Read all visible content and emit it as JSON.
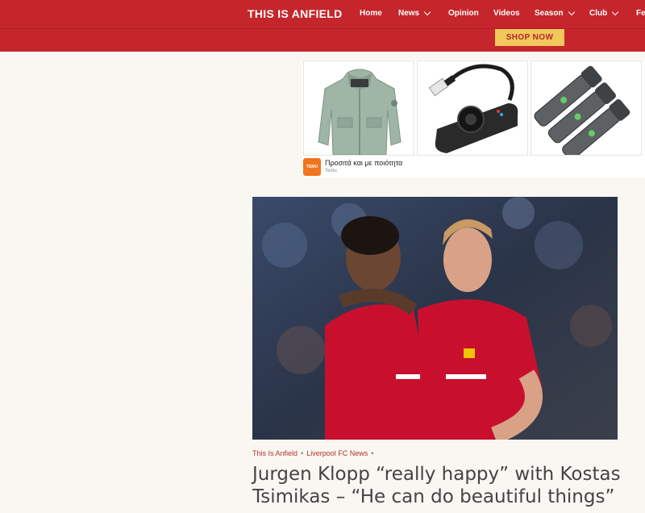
{
  "header": {
    "brand": "THIS IS ANFIELD",
    "nav": [
      {
        "label": "Home",
        "has_dropdown": false
      },
      {
        "label": "News",
        "has_dropdown": true
      },
      {
        "label": "Opinion",
        "has_dropdown": false
      },
      {
        "label": "Videos",
        "has_dropdown": false
      },
      {
        "label": "Season",
        "has_dropdown": true
      },
      {
        "label": "Club",
        "has_dropdown": true
      },
      {
        "label": "Fea",
        "has_dropdown": false
      }
    ],
    "shop_label": "SHOP NOW"
  },
  "ad": {
    "tiles": [
      "jacket-image",
      "usb-sound-card-image",
      "flashlights-image"
    ],
    "advertiser_logo_text": "TEMU",
    "text": "Προσιτά και με ποιότητα",
    "advertiser": "Temu"
  },
  "article": {
    "source": "This Is Anfield",
    "category": "Liverpool FC News",
    "headline": "Jurgen Klopp “really happy” with Kostas Tsimikas – “He can do beautiful things”"
  },
  "colors": {
    "header_red": "#c5262b",
    "shop_yellow": "#f2c75c",
    "link_red": "#b7312c",
    "page_bg": "#faf7f3"
  }
}
